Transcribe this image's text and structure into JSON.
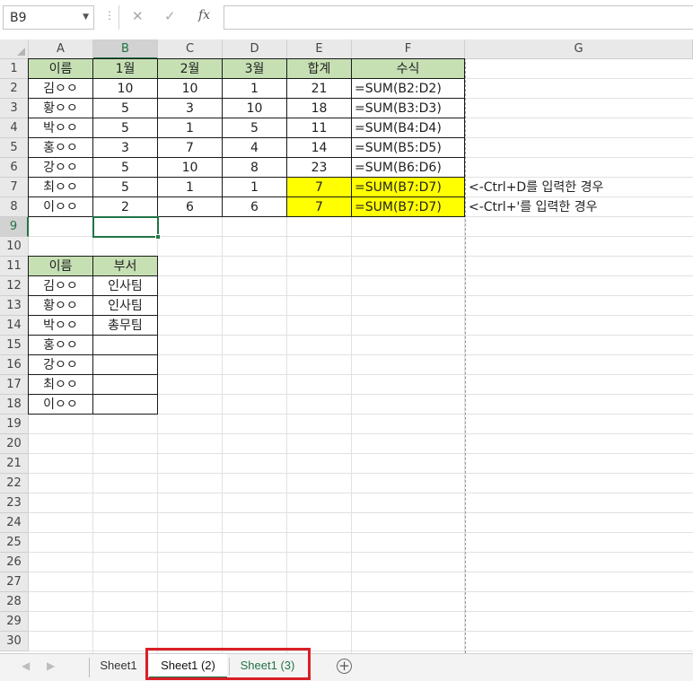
{
  "formula_bar": {
    "name_box": "B9",
    "cancel_icon": "✕",
    "enter_icon": "✓",
    "fx_label": "fx",
    "formula": ""
  },
  "columns": [
    "A",
    "B",
    "C",
    "D",
    "E",
    "F",
    "G"
  ],
  "selected_column": "B",
  "rows": [
    "1",
    "2",
    "3",
    "4",
    "5",
    "6",
    "7",
    "8",
    "9",
    "10",
    "11",
    "12",
    "13",
    "14",
    "15",
    "16",
    "17",
    "18",
    "19",
    "20",
    "21",
    "22",
    "23",
    "24",
    "25",
    "26",
    "27",
    "28",
    "29",
    "30"
  ],
  "selected_row": "9",
  "table1": {
    "headers": [
      "이름",
      "1월",
      "2월",
      "3월",
      "합계",
      "수식"
    ],
    "rows": [
      [
        "김ㅇㅇ",
        "10",
        "10",
        "1",
        "21",
        "=SUM(B2:D2)"
      ],
      [
        "황ㅇㅇ",
        "5",
        "3",
        "10",
        "18",
        "=SUM(B3:D3)"
      ],
      [
        "박ㅇㅇ",
        "5",
        "1",
        "5",
        "11",
        "=SUM(B4:D4)"
      ],
      [
        "홍ㅇㅇ",
        "3",
        "7",
        "4",
        "14",
        "=SUM(B5:D5)"
      ],
      [
        "강ㅇㅇ",
        "5",
        "10",
        "8",
        "23",
        "=SUM(B6:D6)"
      ],
      [
        "최ㅇㅇ",
        "5",
        "1",
        "1",
        "7",
        "=SUM(B7:D7)"
      ],
      [
        "이ㅇㅇ",
        "2",
        "6",
        "6",
        "7",
        "=SUM(B7:D7)"
      ]
    ]
  },
  "notes": {
    "row7": "<-Ctrl+D를 입력한 경우",
    "row8": "<-Ctrl+'를 입력한 경우"
  },
  "table2": {
    "headers": [
      "이름",
      "부서"
    ],
    "rows": [
      [
        "김ㅇㅇ",
        "인사팀"
      ],
      [
        "황ㅇㅇ",
        "인사팀"
      ],
      [
        "박ㅇㅇ",
        "총무팀"
      ],
      [
        "홍ㅇㅇ",
        ""
      ],
      [
        "강ㅇㅇ",
        ""
      ],
      [
        "최ㅇㅇ",
        ""
      ],
      [
        "이ㅇㅇ",
        ""
      ]
    ]
  },
  "colors": {
    "header_fill": "#c6e0b4",
    "highlight_fill": "#ffff00",
    "excel_green": "#217346",
    "callout_red": "#d91f26"
  },
  "sheet_tabs": {
    "tabs": [
      "Sheet1",
      "Sheet1 (2)",
      "Sheet1 (3)"
    ],
    "active": "Sheet1 (2)",
    "add_icon": "+",
    "nav_prev": "◀",
    "nav_next": "▶"
  }
}
